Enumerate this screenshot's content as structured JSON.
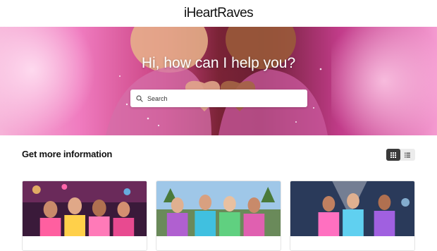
{
  "header": {
    "logo_text": "iHeartRaves"
  },
  "hero": {
    "title": "Hi, how can I help you?"
  },
  "search": {
    "placeholder": "Search",
    "icon": "search-icon"
  },
  "section": {
    "title": "Get more information"
  },
  "view_toggle": {
    "options": [
      "grid-view-icon",
      "list-view-icon"
    ],
    "active": "grid"
  },
  "cards": [
    {
      "label": "",
      "image": "group of ravers at festival night"
    },
    {
      "label": "",
      "image": "ravers in colorful outfits outdoors"
    },
    {
      "label": "",
      "image": "ravers dancing under lights"
    }
  ],
  "colors": {
    "hero_pink": "#f07cc0",
    "hero_dark": "#6b1f33",
    "toggle_active": "#3a3a3a"
  }
}
